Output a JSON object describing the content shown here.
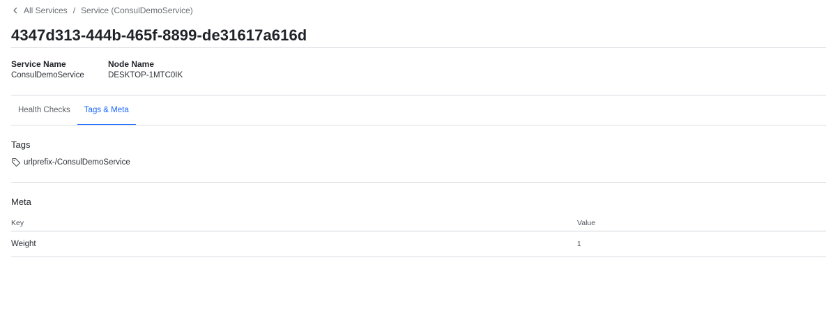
{
  "breadcrumb": {
    "back_label": "All Services",
    "separator": "/",
    "current": "Service (ConsulDemoService)"
  },
  "page": {
    "title": "4347d313-444b-465f-8899-de31617a616d"
  },
  "info": {
    "service_name_label": "Service Name",
    "service_name_value": "ConsulDemoService",
    "node_name_label": "Node Name",
    "node_name_value": "DESKTOP-1MTC0IK"
  },
  "tabs": [
    {
      "label": "Health Checks",
      "active": false
    },
    {
      "label": "Tags & Meta",
      "active": true
    }
  ],
  "tags": {
    "title": "Tags",
    "items": [
      "urlprefix-/ConsulDemoService"
    ]
  },
  "meta": {
    "title": "Meta",
    "columns": [
      "Key",
      "Value"
    ],
    "rows": [
      {
        "key": "Weight",
        "value": "1"
      }
    ]
  },
  "colors": {
    "accent": "#1563ff",
    "text": "#1f2328",
    "muted": "#6a6d74",
    "divider": "#d9dbe0"
  }
}
